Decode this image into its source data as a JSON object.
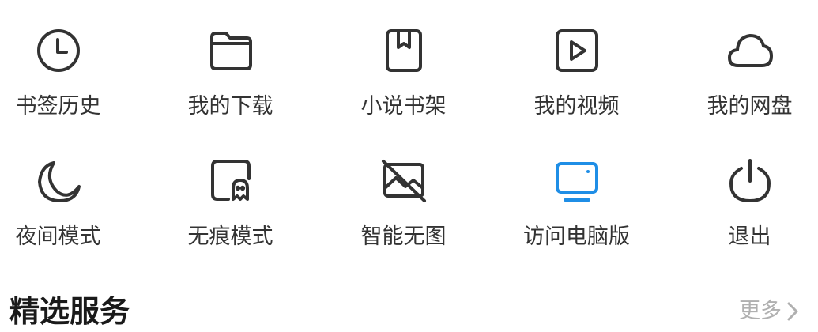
{
  "menu": {
    "items": [
      {
        "label": "书签历史",
        "icon": "clock-icon"
      },
      {
        "label": "我的下载",
        "icon": "folder-icon"
      },
      {
        "label": "小说书架",
        "icon": "book-icon"
      },
      {
        "label": "我的视频",
        "icon": "video-play-icon"
      },
      {
        "label": "我的网盘",
        "icon": "cloud-icon"
      },
      {
        "label": "夜间模式",
        "icon": "moon-icon"
      },
      {
        "label": "无痕模式",
        "icon": "ghost-icon"
      },
      {
        "label": "智能无图",
        "icon": "no-image-icon"
      },
      {
        "label": "访问电脑版",
        "icon": "desktop-monitor-icon"
      },
      {
        "label": "退出",
        "icon": "power-icon"
      }
    ]
  },
  "section": {
    "title": "精选服务",
    "more_label": "更多"
  },
  "colors": {
    "icon_default": "#333333",
    "icon_accent": "#1f8ee6",
    "muted_text": "#b0b0b0"
  }
}
